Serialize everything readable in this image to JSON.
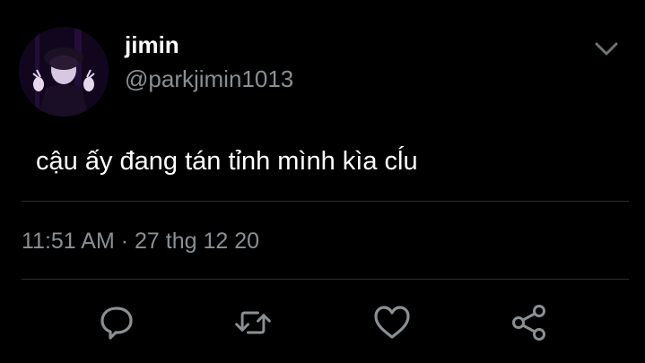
{
  "tweet": {
    "display_name": "jimin",
    "handle": "@parkjimin1013",
    "text": "cậu ấy đang tán tỉnh mình kìa cĺu",
    "timestamp": "11:51 AM · 27 thg 12 20"
  },
  "icons": {
    "more": "chevron-down-icon",
    "reply": "reply-icon",
    "retweet": "retweet-icon",
    "like": "like-icon",
    "share": "share-icon"
  },
  "colors": {
    "background": "#000000",
    "primary_text": "#ffffff",
    "secondary_text": "#8a8f94",
    "divider": "#2a2d31",
    "icon": "#8a8f94"
  }
}
